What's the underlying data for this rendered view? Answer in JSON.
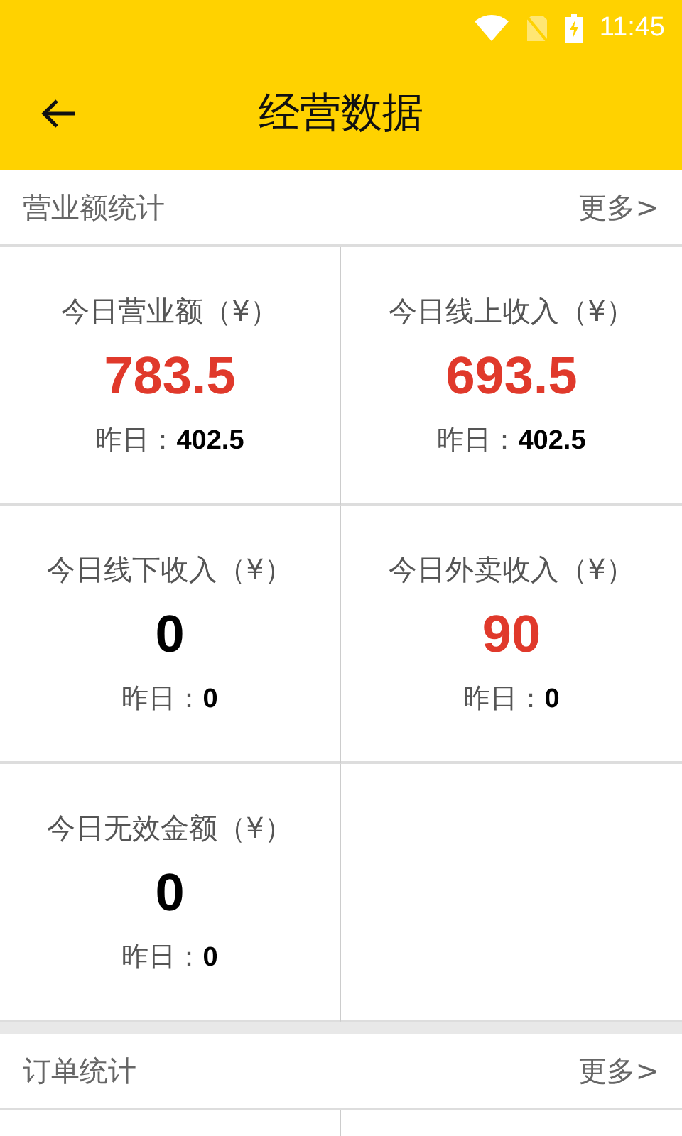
{
  "status_bar": {
    "time": "11:45"
  },
  "toolbar": {
    "title": "经营数据"
  },
  "revenue_section": {
    "title": "营业额统计",
    "more": "更多>",
    "cards": [
      {
        "label": "今日营业额（¥）",
        "value": "783.5",
        "color": "#e0392b",
        "yesterday_label": "昨日：",
        "yesterday_value": "402.5"
      },
      {
        "label": "今日线上收入（¥）",
        "value": "693.5",
        "color": "#e0392b",
        "yesterday_label": "昨日：",
        "yesterday_value": "402.5"
      },
      {
        "label": "今日线下收入（¥）",
        "value": "0",
        "color": "#000000",
        "yesterday_label": "昨日：",
        "yesterday_value": "0"
      },
      {
        "label": "今日外卖收入（¥）",
        "value": "90",
        "color": "#e0392b",
        "yesterday_label": "昨日：",
        "yesterday_value": "0"
      },
      {
        "label": "今日无效金额（¥）",
        "value": "0",
        "color": "#000000",
        "yesterday_label": "昨日：",
        "yesterday_value": "0"
      }
    ]
  },
  "order_section": {
    "title": "订单统计",
    "more": "更多>"
  }
}
